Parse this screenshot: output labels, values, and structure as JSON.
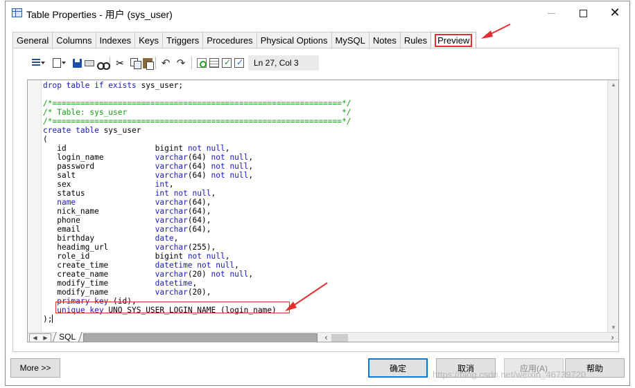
{
  "window": {
    "title": "Table Properties - 用户 (sys_user)"
  },
  "tabs": [
    {
      "label": "General"
    },
    {
      "label": "Columns"
    },
    {
      "label": "Indexes"
    },
    {
      "label": "Keys"
    },
    {
      "label": "Triggers"
    },
    {
      "label": "Procedures"
    },
    {
      "label": "Physical Options"
    },
    {
      "label": "MySQL"
    },
    {
      "label": "Notes"
    },
    {
      "label": "Rules"
    },
    {
      "label": "Preview",
      "active": true
    }
  ],
  "toolbar": {
    "icons": [
      "list-icon",
      "edit-icon",
      "save-icon",
      "print-icon",
      "find-icon",
      "cut-icon",
      "copy-icon",
      "paste-icon",
      "undo-icon",
      "redo-icon",
      "refresh-icon",
      "properties-icon",
      "generate-icon",
      "check-icon"
    ],
    "position": "Ln 27, Col 3"
  },
  "editor": {
    "sheet_tab": "SQL"
  },
  "colors": {
    "keyword": "#1a1ab8",
    "comment": "#1a9a1a",
    "annotation": "#e03030",
    "default_button_border": "#0078d7"
  },
  "buttons": {
    "more": "More >>",
    "ok": "确定",
    "cancel": "取消",
    "apply": "应用(A)",
    "help": "帮助"
  },
  "watermark": "https://blog.csdn.net/weixin_46739720"
}
